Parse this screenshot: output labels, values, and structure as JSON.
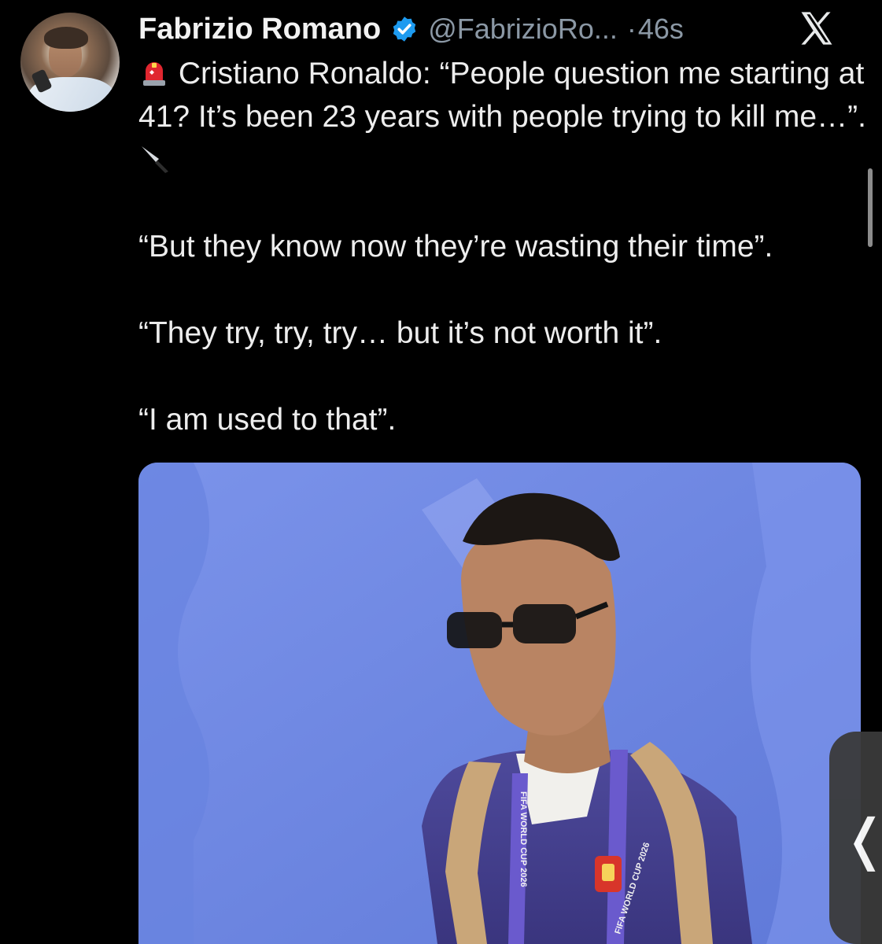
{
  "author": {
    "name": "Fabrizio Romano",
    "handle": "@FabrizioRo...",
    "separator": "·",
    "time": "46s",
    "avatar_icon": "profile-photo",
    "verified_icon": "verified-badge-icon",
    "verified_color": "#1d9bf0"
  },
  "tweet": {
    "lead_emoji": "rotating-light-icon",
    "line1": "Cristiano Ronaldo: “People question me starting at 41? It’s been 23 years with people trying to kill me…”.",
    "knife_emoji": "knife-icon",
    "line2": "“But they know now they’re wasting their time”.",
    "line3": "“They try, try, try… but it’s not worth it”.",
    "line4": "“I am used to that”."
  },
  "media": {
    "lanyard_text_left": "FIFA WORLD CUP 2026",
    "lanyard_text_right": "FIFA WORLD CUP 2026",
    "background_color": "#6f8ae3"
  },
  "app": {
    "logo_icon": "x-logo-icon",
    "side_tab_icon": "chevron-left-icon",
    "side_tab_glyph": "❬"
  }
}
